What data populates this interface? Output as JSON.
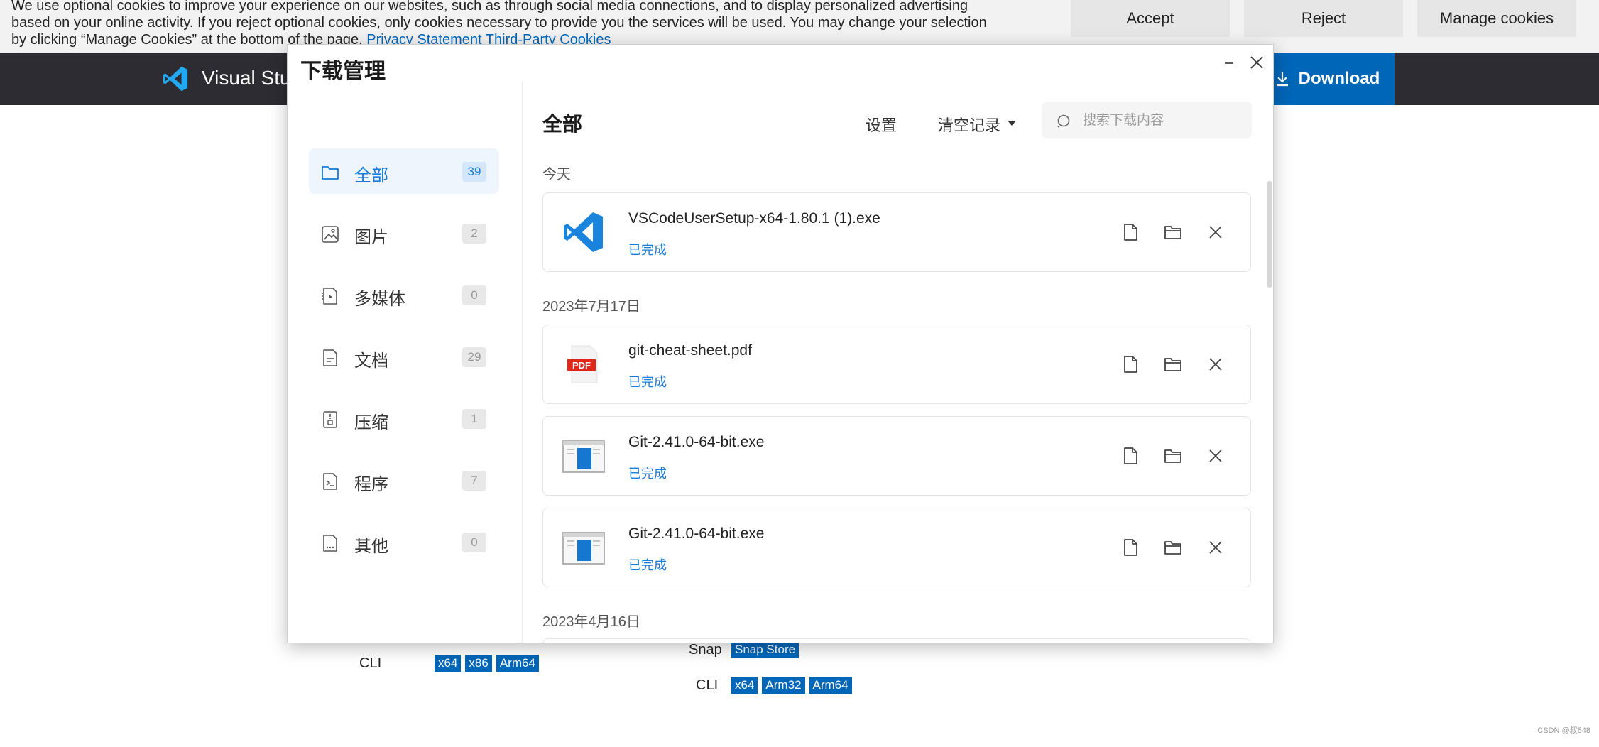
{
  "cookie_banner": {
    "text": "We use optional cookies to improve your experience on our websites, such as through social media connections, and to display personalized advertising based on your online activity. If you reject optional cookies, only cookies necessary to provide you the services will be used. You may change your selection by clicking “Manage Cookies” at the bottom of the page.",
    "privacy_link": "Privacy Statement",
    "third_party_link": "Third-Party Cookies",
    "accept_label": "Accept",
    "reject_label": "Reject",
    "manage_label": "Manage cookies"
  },
  "site_header": {
    "title": "Visual Stu",
    "download_label": "Download",
    "brand_color": "#0066b8"
  },
  "background_page": {
    "cli_left_label": "CLI",
    "cli_left_badges": [
      "x64",
      "x86",
      "Arm64"
    ],
    "snap_label": "Snap",
    "snap_badge": "Snap Store",
    "cli_right_label": "CLI",
    "cli_right_badges": [
      "x64",
      "Arm32",
      "Arm64"
    ],
    "watermark": "CSDN @叔548"
  },
  "dialog": {
    "title": "下载管理",
    "sidebar": [
      {
        "label": "全部",
        "count": "39",
        "icon": "folder-icon",
        "active": true
      },
      {
        "label": "图片",
        "count": "2",
        "icon": "image-icon",
        "active": false
      },
      {
        "label": "多媒体",
        "count": "0",
        "icon": "media-icon",
        "active": false
      },
      {
        "label": "文档",
        "count": "29",
        "icon": "document-icon",
        "active": false
      },
      {
        "label": "压缩",
        "count": "1",
        "icon": "archive-icon",
        "active": false
      },
      {
        "label": "程序",
        "count": "7",
        "icon": "program-icon",
        "active": false
      },
      {
        "label": "其他",
        "count": "0",
        "icon": "other-icon",
        "active": false
      }
    ],
    "main": {
      "title": "全部",
      "settings_label": "设置",
      "clear_label": "清空记录",
      "search_placeholder": "搜索下载内容",
      "groups": [
        {
          "date": "今天",
          "items": [
            {
              "name": "VSCodeUserSetup-x64-1.80.1 (1).exe",
              "status": "已完成",
              "icon": "vscode-icon"
            }
          ]
        },
        {
          "date": "2023年7月17日",
          "items": [
            {
              "name": "git-cheat-sheet.pdf",
              "status": "已完成",
              "icon": "pdf-icon"
            },
            {
              "name": "Git-2.41.0-64-bit.exe",
              "status": "已完成",
              "icon": "installer-icon"
            },
            {
              "name": "Git-2.41.0-64-bit.exe",
              "status": "已完成",
              "icon": "installer-icon"
            }
          ]
        },
        {
          "date": "2023年4月16日",
          "items": []
        }
      ],
      "accent_color": "#1a7ad8"
    }
  }
}
